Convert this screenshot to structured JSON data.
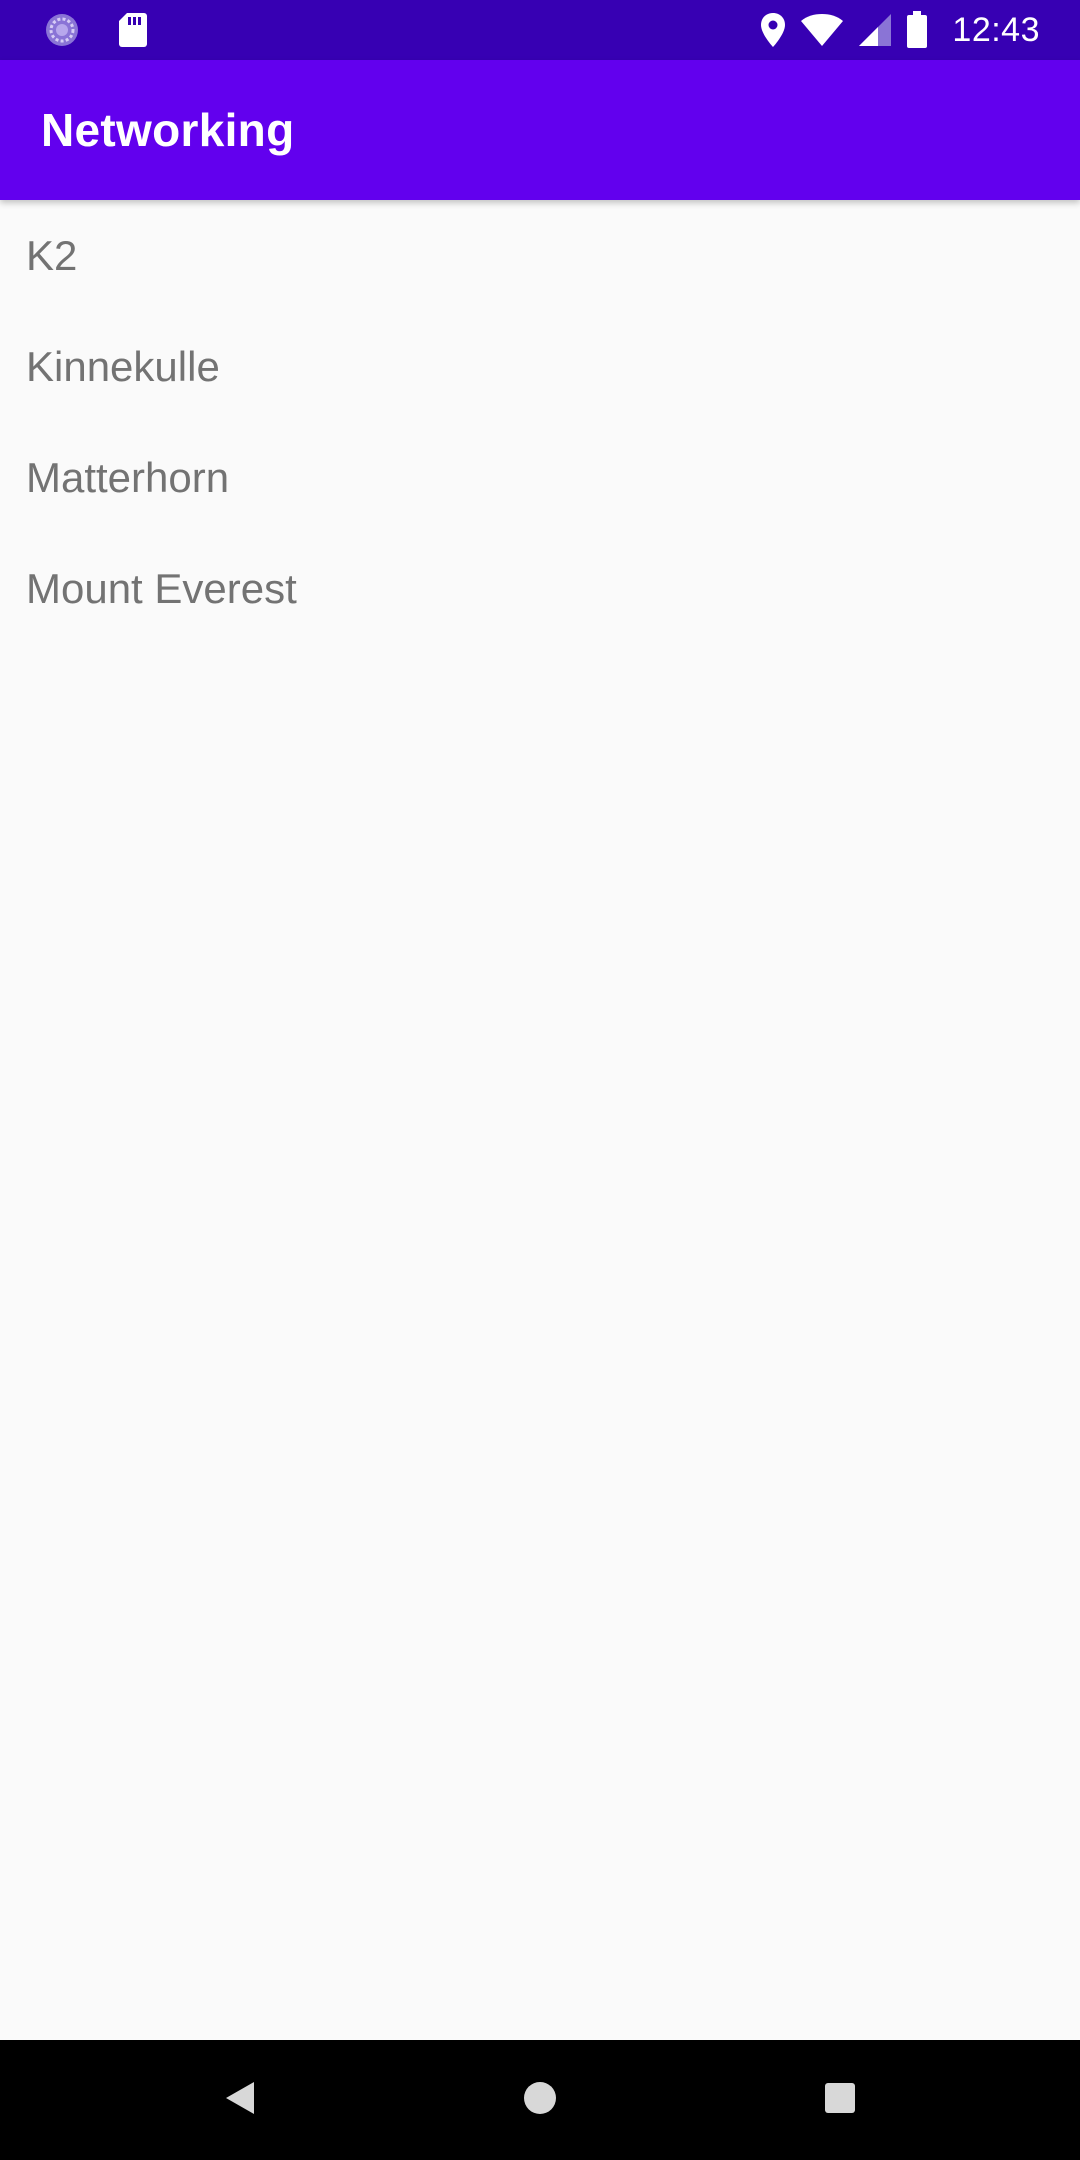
{
  "status_bar": {
    "time": "12:43",
    "background_color": "#3700b3",
    "left_icons": [
      "loading-circle-icon",
      "sd-card-icon"
    ],
    "right_icons": [
      "location-pin-icon",
      "wifi-icon",
      "cell-signal-icon",
      "battery-icon"
    ]
  },
  "app_bar": {
    "title": "Networking",
    "background_color": "#6200ee"
  },
  "list": {
    "items": [
      {
        "label": "K2"
      },
      {
        "label": "Kinnekulle"
      },
      {
        "label": "Matterhorn"
      },
      {
        "label": "Mount Everest"
      }
    ]
  },
  "nav_bar": {
    "buttons": [
      "back-icon",
      "home-icon",
      "recents-icon"
    ]
  }
}
